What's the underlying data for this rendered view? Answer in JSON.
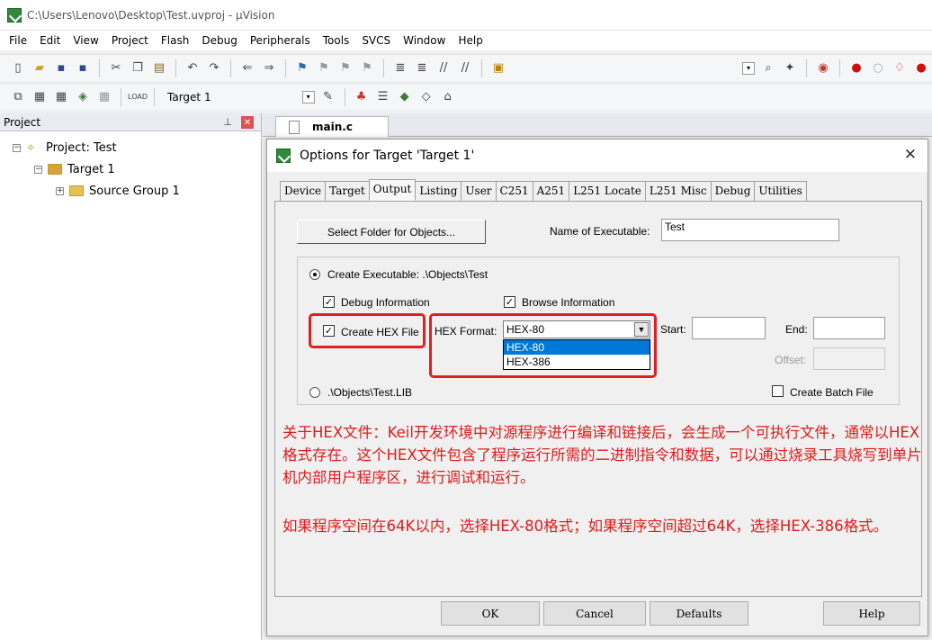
{
  "window": {
    "title": "C:\\Users\\Lenovo\\Desktop\\Test.uvproj - µVision"
  },
  "menu": [
    "File",
    "Edit",
    "View",
    "Project",
    "Flash",
    "Debug",
    "Peripherals",
    "Tools",
    "SVCS",
    "Window",
    "Help"
  ],
  "toolbar2": {
    "target_label": "Target 1"
  },
  "project_panel": {
    "header": "Project",
    "tree": {
      "project": "Project: Test",
      "target": "Target 1",
      "group": "Source Group 1"
    }
  },
  "editor": {
    "tab": "main.c"
  },
  "dialog": {
    "title": "Options for Target 'Target 1'",
    "tabs": [
      "Device",
      "Target",
      "Output",
      "Listing",
      "User",
      "C251",
      "A251",
      "L251 Locate",
      "L251 Misc",
      "Debug",
      "Utilities"
    ],
    "active_tab": "Output",
    "select_folder_button": "Select Folder for Objects...",
    "name_of_executable_label": "Name of Executable:",
    "name_of_executable_value": "Test",
    "create_executable_label": "Create Executable:  .\\Objects\\Test",
    "debug_information_label": "Debug Information",
    "debug_information_checked": true,
    "browse_information_label": "Browse Information",
    "browse_information_checked": true,
    "create_hex_label": "Create HEX File",
    "create_hex_checked": true,
    "hex_format_label": "HEX Format:",
    "hex_format_value": "HEX-80",
    "hex_format_options": [
      "HEX-80",
      "HEX-386"
    ],
    "start_label": "Start:",
    "end_label": "End:",
    "offset_label": "Offset:",
    "library_label": ".\\Objects\\Test.LIB",
    "create_batch_label": "Create Batch File",
    "create_batch_checked": false,
    "note_1": "关于HEX文件：Keil开发环境中对源程序进行编译和链接后，会生成一个可执行文件，通常以HEX格式存在。这个HEX文件包含了程序运行所需的二进制指令和数据，可以通过烧录工具烧写到单片机内部用户程序区，进行调试和运行。",
    "note_2": "如果程序空间在64K以内，选择HEX-80格式；如果程序空间超过64K，选择HEX-386格式。",
    "buttons": {
      "ok": "OK",
      "cancel": "Cancel",
      "defaults": "Defaults",
      "help": "Help"
    }
  },
  "colors": {
    "annotation_red": "#e02020",
    "selection_blue": "#0078d7"
  }
}
